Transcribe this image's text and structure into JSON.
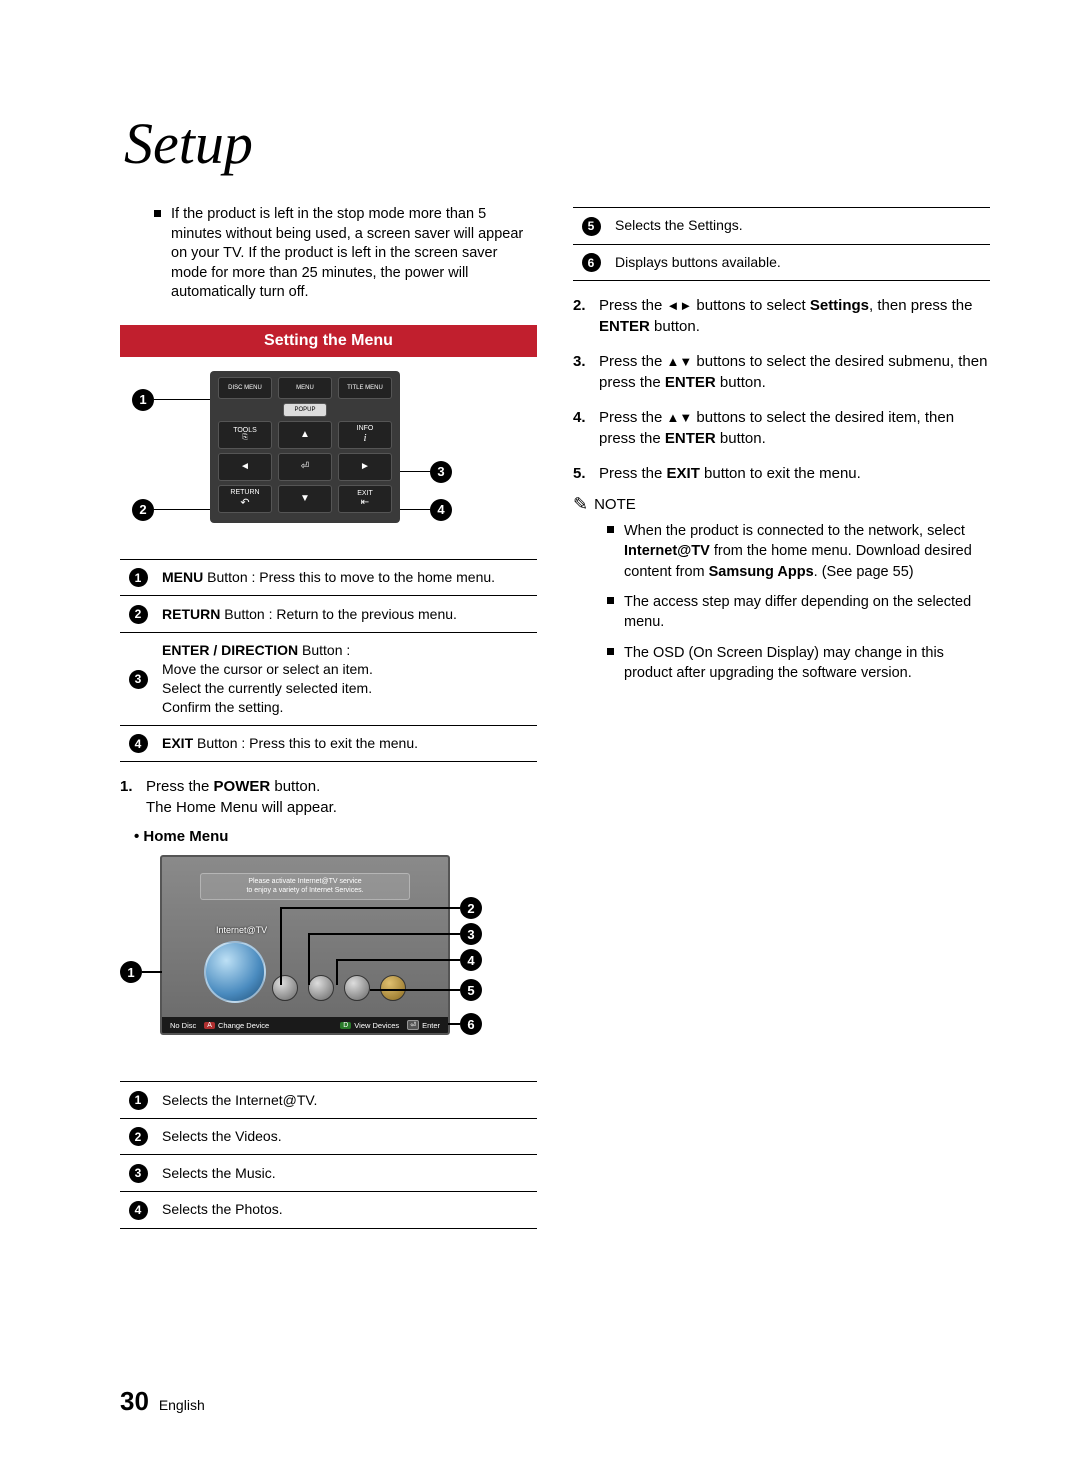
{
  "title": "Setup",
  "intro_bullet": "If the product is left in the stop mode more than 5 minutes without being used, a screen saver will appear on your TV. If the product is left in the screen saver mode for more than 25 minutes, the power will automatically turn off.",
  "section_heading": "Setting the Menu",
  "remote": {
    "disc_menu": "DISC MENU",
    "menu": "MENU",
    "title_menu": "TITLE MENU",
    "popup": "POPUP",
    "tools": "TOOLS",
    "info": "INFO",
    "return": "RETURN",
    "exit": "EXIT"
  },
  "remote_callouts": [
    {
      "num": "1",
      "bold": "MENU",
      "text": " Button : Press this to move to the home menu."
    },
    {
      "num": "2",
      "bold": "RETURN",
      "text": " Button : Return to the previous menu."
    },
    {
      "num": "3",
      "bold": "ENTER / DIRECTION",
      "text": " Button :\nMove the cursor or select an item.\nSelect the currently selected item.\nConfirm the setting."
    },
    {
      "num": "4",
      "bold": "EXIT",
      "text": " Button : Press this to exit the menu."
    }
  ],
  "step1": {
    "num": "1.",
    "pre": "Press the ",
    "bold": "POWER",
    "post": " button.",
    "line2": "The Home Menu will appear."
  },
  "home_menu_label": "• Home Menu",
  "home_screen": {
    "banner1": "Please activate Internet@TV service",
    "banner2": "to enjoy a variety of Internet Services.",
    "internet": "Internet@TV",
    "nodisc": "No Disc",
    "change": "Change Device",
    "view": "View Devices",
    "enter": "Enter",
    "keyA": "A",
    "keyB": "D",
    "keyE": "⏎"
  },
  "home_callouts_left": [
    {
      "num": "1",
      "text": "Selects the Internet@TV."
    },
    {
      "num": "2",
      "text": "Selects the Videos."
    },
    {
      "num": "3",
      "text": "Selects the Music."
    },
    {
      "num": "4",
      "text": "Selects the Photos."
    }
  ],
  "home_callouts_right": [
    {
      "num": "5",
      "text": "Selects the Settings."
    },
    {
      "num": "6",
      "text": "Displays buttons available."
    }
  ],
  "steps_right": [
    {
      "num": "2.",
      "parts": [
        "Press the ",
        "◄►",
        " buttons to select ",
        "Settings",
        ", then press the ",
        "ENTER",
        " button."
      ]
    },
    {
      "num": "3.",
      "parts": [
        "Press the ",
        "▲▼",
        " buttons to select the desired submenu, then press the ",
        "ENTER",
        " button."
      ]
    },
    {
      "num": "4.",
      "parts": [
        "Press the ",
        "▲▼",
        " buttons to select the desired item, then press the ",
        "ENTER",
        " button."
      ]
    },
    {
      "num": "5.",
      "parts": [
        "Press the ",
        "EXIT",
        " button to exit the menu."
      ]
    }
  ],
  "note_label": "NOTE",
  "notes": [
    {
      "pre": "When the product is connected to the network, select ",
      "b1": "Internet@TV",
      "mid": " from the home menu. Download desired content from ",
      "b2": "Samsung Apps",
      "post": ". (See page 55)"
    },
    {
      "text": "The access step may differ depending on the selected menu."
    },
    {
      "text": "The OSD (On Screen Display) may change in this product after upgrading the software version."
    }
  ],
  "footer": {
    "page": "30",
    "lang": "English"
  }
}
